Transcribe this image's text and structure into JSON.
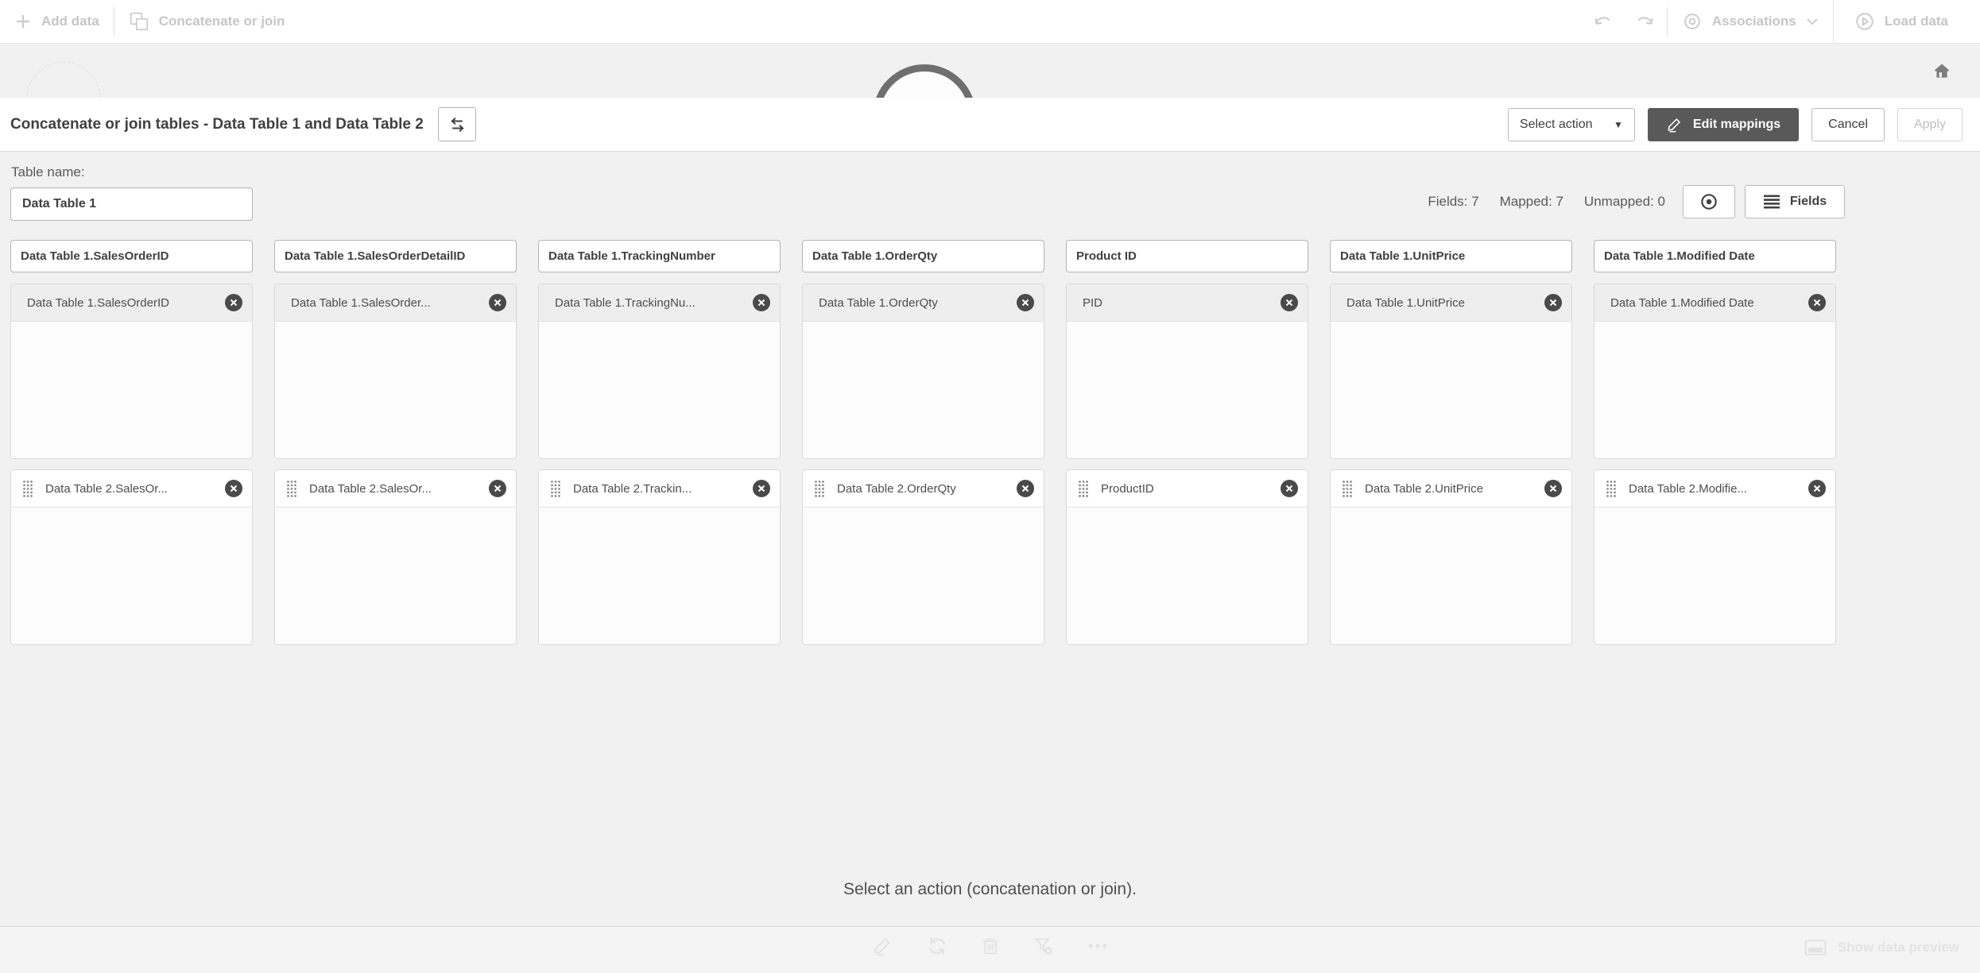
{
  "top_toolbar": {
    "add_data_label": "Add data",
    "concatenate_label": "Concatenate or join",
    "associations_label": "Associations",
    "load_data_label": "Load data"
  },
  "header": {
    "title": "Concatenate or join tables - Data Table 1 and Data Table 2",
    "select_action_label": "Select action",
    "edit_mappings_label": "Edit mappings",
    "cancel_label": "Cancel",
    "apply_label": "Apply"
  },
  "subheader": {
    "table_name_label": "Table name:",
    "table_name_value": "Data Table 1",
    "fields_count": "Fields: 7",
    "mapped_count": "Mapped: 7",
    "unmapped_count": "Unmapped: 0",
    "fields_button_label": "Fields"
  },
  "columns": [
    {
      "header": "Data Table 1.SalesOrderID",
      "row1_chip": "Data Table 1.SalesOrderID",
      "row2_chip": "Data Table 2.SalesOr..."
    },
    {
      "header": "Data Table 1.SalesOrderDetailID",
      "row1_chip": "Data Table 1.SalesOrder...",
      "row2_chip": "Data Table 2.SalesOr..."
    },
    {
      "header": "Data Table 1.TrackingNumber",
      "row1_chip": "Data Table 1.TrackingNu...",
      "row2_chip": "Data Table 2.Trackin..."
    },
    {
      "header": "Data Table 1.OrderQty",
      "row1_chip": "Data Table 1.OrderQty",
      "row2_chip": "Data Table 2.OrderQty"
    },
    {
      "header": "Product ID",
      "row1_chip": "PID",
      "row2_chip": "ProductID"
    },
    {
      "header": "Data Table 1.UnitPrice",
      "row1_chip": "Data Table 1.UnitPrice",
      "row2_chip": "Data Table 2.UnitPrice"
    },
    {
      "header": "Data Table 1.Modified Date",
      "row1_chip": "Data Table 1.Modified Date",
      "row2_chip": "Data Table 2.Modifie..."
    }
  ],
  "footer": {
    "hint": "Select an action (concatenation or join).",
    "show_data_preview_label": "Show data preview"
  },
  "icons": {
    "top_toolbar": [
      "plus-icon",
      "concatenate-icon",
      "undo-icon",
      "redo-icon",
      "eye-icon",
      "chevron-down-icon",
      "play-circle-icon",
      "home-icon"
    ],
    "header": [
      "swap-icon",
      "caret-down-icon",
      "pencil-icon"
    ],
    "subheader": [
      "preview-eye-icon",
      "list-icon"
    ],
    "chips": [
      "close-icon",
      "drag-handle-icon"
    ],
    "footer": [
      "pencil-icon",
      "refresh-icon",
      "trash-icon",
      "filter-clear-icon",
      "ellipsis-icon",
      "preview-panel-icon"
    ]
  },
  "colors": {
    "accent_dark_button": "#595959",
    "content_background": "#f1f1f1",
    "card_border": "#d9d9d9",
    "chip_close": "#4a4a4a",
    "disabled_text": "#c6c6c6",
    "text": "#404040"
  }
}
